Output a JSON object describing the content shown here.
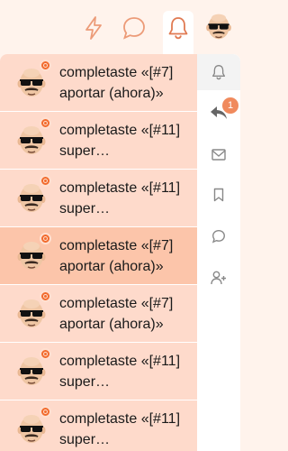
{
  "header": {
    "icons": [
      "lightning-icon",
      "chat-bubble-icon",
      "bell-icon",
      "user-avatar"
    ],
    "accent_color": "#f26b2d"
  },
  "notifications": [
    {
      "text": "completaste «[#7] aportar (ahora)»",
      "highlighted": false
    },
    {
      "text": "completaste «[#11] super…",
      "highlighted": false
    },
    {
      "text": "completaste «[#11] super…",
      "highlighted": false
    },
    {
      "text": "completaste «[#7] aportar (ahora)»",
      "highlighted": true
    },
    {
      "text": "completaste «[#7] aportar (ahora)»",
      "highlighted": false
    },
    {
      "text": "completaste «[#11] super…",
      "highlighted": false
    },
    {
      "text": "completaste «[#11] super…",
      "highlighted": false
    }
  ],
  "rail": {
    "items": [
      "bell-icon",
      "reply-icon",
      "mail-icon",
      "bookmark-icon",
      "chat-icon",
      "user-plus-icon"
    ],
    "reply_badge": "1"
  }
}
